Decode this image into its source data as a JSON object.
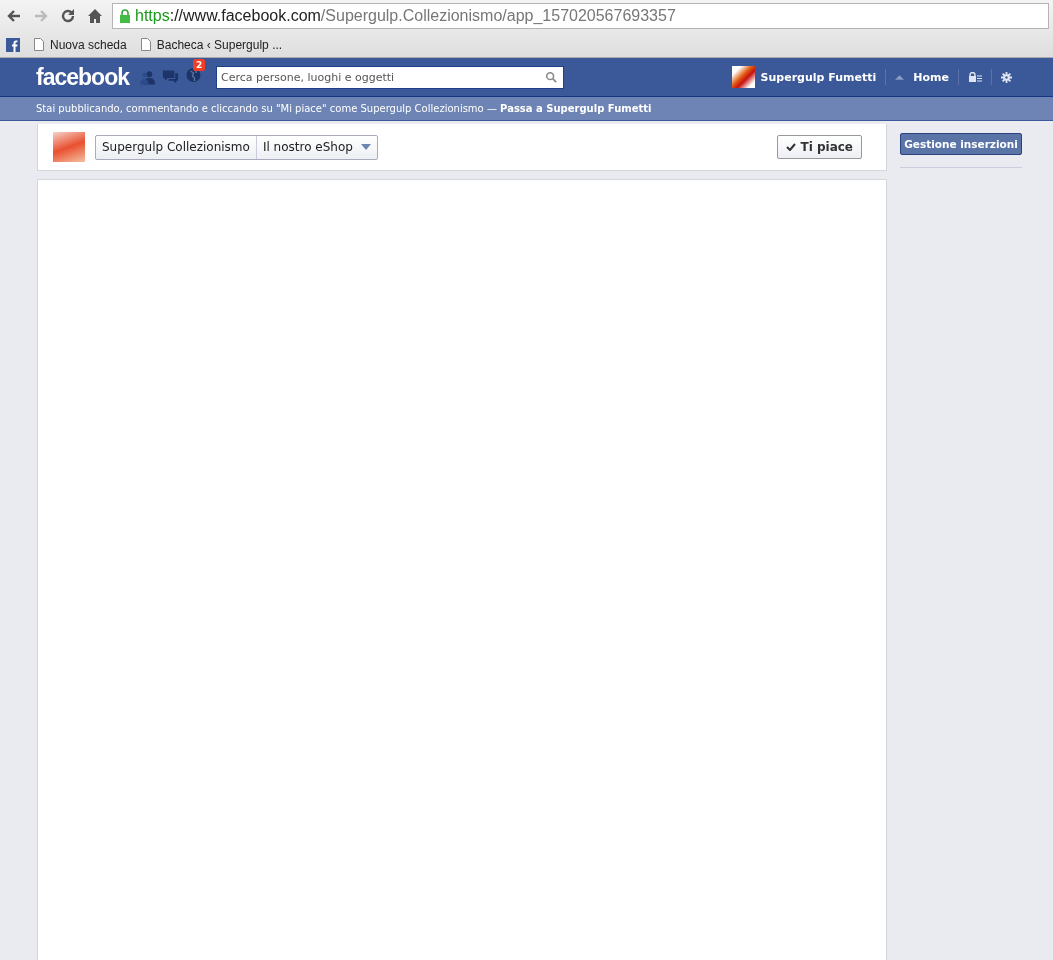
{
  "browser": {
    "address": [
      {
        "kind": "scheme",
        "text": "https"
      },
      {
        "kind": "host",
        "text": "://www.facebook.com"
      },
      {
        "kind": "path",
        "text": "/Supergulp.Collezionismo/app_157020567693357"
      }
    ],
    "bookmarks": [
      {
        "label": "Nuova scheda"
      },
      {
        "label": "Bacheca ‹ Supergulp ..."
      }
    ]
  },
  "topbar": {
    "logo": "facebook",
    "notifications_badge": "2",
    "search": {
      "placeholder": "Cerca persone, luoghi e oggetti"
    },
    "profile": "Supergulp Fumetti",
    "home": "Home"
  },
  "notice": {
    "text": "Stai pubblicando, commentando e cliccando su \"Mi piace\" come Supergulp Collezionismo — **Passa a Supergulp Fumetti**"
  },
  "page_header": {
    "page_name": "Supergulp Collezionismo",
    "tab": "Il nostro eShop",
    "like_button": "Ti piace",
    "liked": true
  },
  "sidebar": {
    "button": "Gestione inserzioni"
  }
}
